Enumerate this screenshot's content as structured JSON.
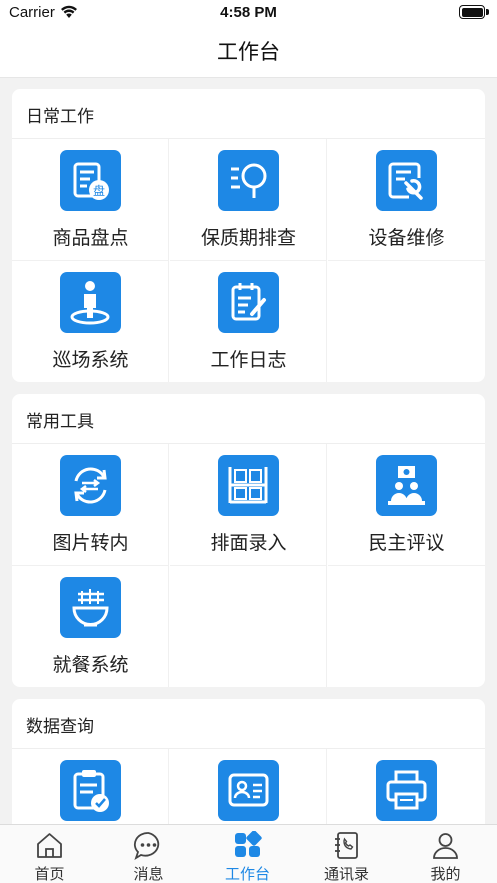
{
  "status_bar": {
    "carrier": "Carrier",
    "time": "4:58 PM"
  },
  "nav": {
    "title": "工作台"
  },
  "accent_color": "#1e88e5",
  "sections": [
    {
      "title": "日常工作",
      "items": [
        {
          "label": "商品盘点",
          "icon": "inventory-check-icon"
        },
        {
          "label": "保质期排查",
          "icon": "shelf-life-search-icon"
        },
        {
          "label": "设备维修",
          "icon": "equipment-repair-icon"
        },
        {
          "label": "巡场系统",
          "icon": "patrol-person-icon"
        },
        {
          "label": "工作日志",
          "icon": "work-log-icon"
        }
      ]
    },
    {
      "title": "常用工具",
      "items": [
        {
          "label": "图片转内",
          "icon": "image-transfer-icon"
        },
        {
          "label": "排面录入",
          "icon": "shelf-entry-icon"
        },
        {
          "label": "民主评议",
          "icon": "democratic-review-icon"
        },
        {
          "label": "就餐系统",
          "icon": "dining-bowl-icon"
        }
      ]
    },
    {
      "title": "数据查询",
      "items": [
        {
          "label": "",
          "icon": "clipboard-check-icon"
        },
        {
          "label": "",
          "icon": "id-card-icon"
        },
        {
          "label": "",
          "icon": "printer-icon"
        }
      ]
    }
  ],
  "tabs": [
    {
      "label": "首页",
      "icon": "home-icon"
    },
    {
      "label": "消息",
      "icon": "message-icon"
    },
    {
      "label": "工作台",
      "icon": "workbench-icon",
      "active": true
    },
    {
      "label": "通讯录",
      "icon": "contacts-icon"
    },
    {
      "label": "我的",
      "icon": "profile-icon"
    }
  ]
}
